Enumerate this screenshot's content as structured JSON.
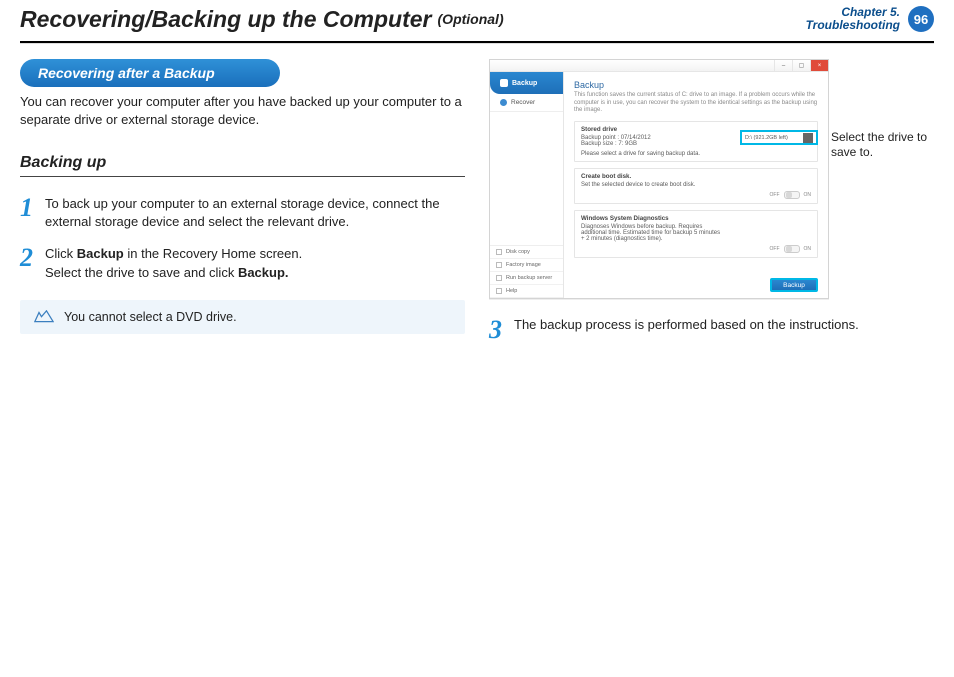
{
  "header": {
    "title": "Recovering/Backing up the Computer",
    "optional": "(Optional)",
    "chapter_line1": "Chapter 5.",
    "chapter_line2": "Troubleshooting",
    "page": "96"
  },
  "left": {
    "pill": "Recovering after a Backup",
    "intro": "You can recover your computer after you have backed up your computer to a separate drive or external storage device.",
    "sub": "Backing up",
    "s1": "To back up your computer to an external storage device, connect the external storage device and select the relevant drive.",
    "s2a": "Click ",
    "s2b": "Backup",
    "s2c": " in the Recovery Home screen.",
    "s2d": "Select the drive to save and click ",
    "s2e": "Backup.",
    "note": "You cannot select a DVD drive."
  },
  "right": {
    "callout": "Select the drive to save to.",
    "s3": "The backup process is performed based on the instructions."
  },
  "nums": {
    "n1": "1",
    "n2": "2",
    "n3": "3"
  },
  "shot": {
    "sidebar_active": "Backup",
    "sidebar_item": "Recover",
    "sb1": "Disk copy",
    "sb2": "Factory image",
    "sb3": "Run backup server",
    "sb4": "Help",
    "title": "Backup",
    "desc": "This function saves the current status of C: drive to an image. If a problem occurs while the computer is in use, you can recover the system to the identical settings as the backup using the image.",
    "sect1_t": "Stored drive",
    "sect1_l1": "Backup point : 07/14/2012",
    "sect1_l2": "Backup size : 7: 9GB",
    "sect1_l3": "Please select a drive for saving backup data.",
    "drive": "D:\\ (921.2GB left)",
    "sect2_t": "Create boot disk.",
    "sect2_l": "Set the selected device to create boot disk.",
    "sect3_t": "Windows System Diagnostics",
    "sect3_l": "Diagnoses Windows before backup. Requires additional time. Estimated time for backup 5 minutes + 2 minutes (diagnostics time).",
    "off": "OFF",
    "on": "ON",
    "btn": "Backup",
    "close": "×",
    "min": "–",
    "max": "▢"
  }
}
